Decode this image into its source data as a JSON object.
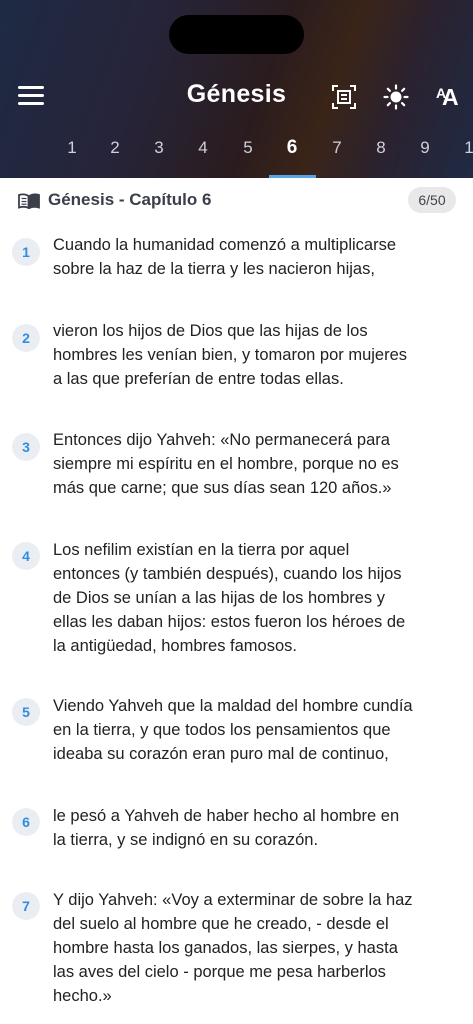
{
  "header": {
    "title": "Génesis",
    "chapter_tabs": [
      "1",
      "2",
      "3",
      "4",
      "5",
      "6",
      "7",
      "8",
      "9",
      "1"
    ],
    "active_tab": "6"
  },
  "chapter_bar": {
    "title": "Génesis - Capítulo 6",
    "badge": "6/50"
  },
  "colors": {
    "accent": "#2f8ee0",
    "tab_underline": "#58a6e8",
    "header_dark": "#1e2a44"
  },
  "icons": [
    "menu-icon",
    "focus-frame-icon",
    "brightness-icon",
    "font-size-icon",
    "book-open-icon"
  ],
  "verses": [
    {
      "num": "1",
      "lines": [
        "Cuando la humanidad comenzó a multiplicarse",
        "sobre la haz de la tierra y les nacieron hijas,"
      ]
    },
    {
      "num": "2",
      "lines": [
        "vieron los hijos de Dios que las hijas de los",
        "hombres les venían bien, y tomaron por mujeres",
        "a las que preferían de entre todas ellas."
      ]
    },
    {
      "num": "3",
      "lines": [
        "Entonces dijo Yahveh: «No permanecerá para",
        "siempre mi espíritu en el hombre, porque no es",
        "más que carne; que sus días sean 120 años.»"
      ]
    },
    {
      "num": "4",
      "lines": [
        "Los nefilim existían en la tierra por aquel",
        "entonces (y también después), cuando los hijos",
        "de Dios se unían a las hijas de los hombres y",
        "ellas les daban hijos: estos fueron los héroes de",
        "la antigüedad, hombres famosos."
      ]
    },
    {
      "num": "5",
      "lines": [
        "Viendo Yahveh que la maldad del hombre cundía",
        "en la tierra, y que todos los pensamientos que",
        "ideaba su corazón eran puro mal de continuo,"
      ]
    },
    {
      "num": "6",
      "lines": [
        "le pesó a Yahveh de haber hecho al hombre en",
        "la tierra, y se indignó en su corazón."
      ]
    },
    {
      "num": "7",
      "lines": [
        "Y dijo Yahveh: «Voy a exterminar de sobre la haz",
        "del suelo al hombre que he creado, - desde el",
        "hombre hasta los ganados, las sierpes, y hasta",
        "las aves del cielo - porque me pesa harberlos",
        "hecho.»"
      ]
    }
  ]
}
